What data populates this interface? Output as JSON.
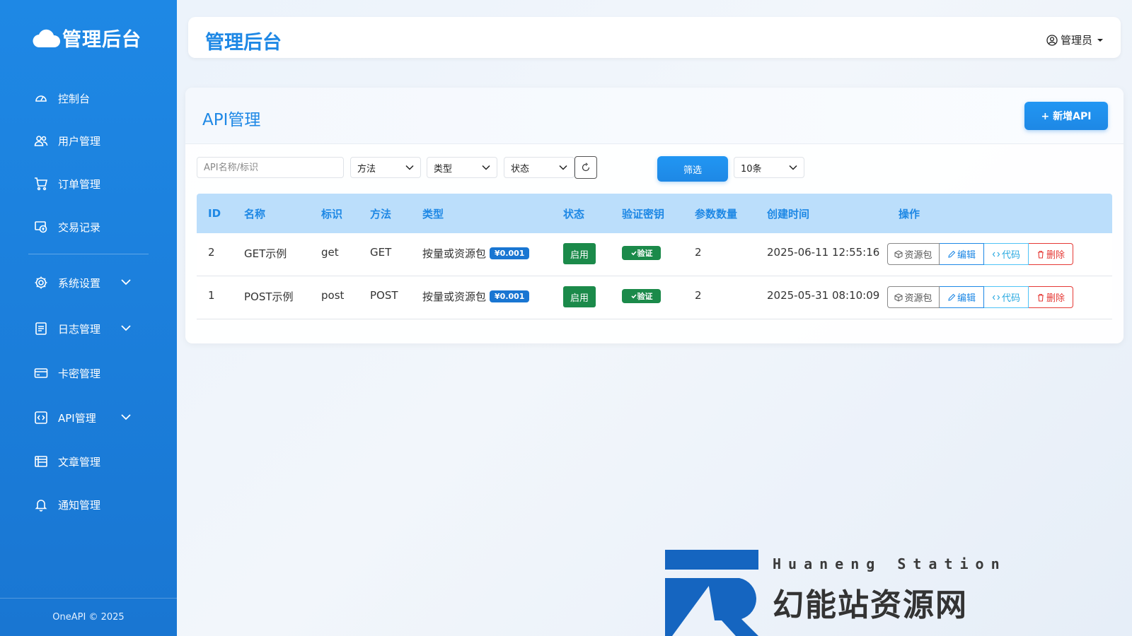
{
  "sidebar": {
    "brand": "管理后台",
    "items": [
      {
        "label": "控制台",
        "icon": "dashboard-icon"
      },
      {
        "label": "用户管理",
        "icon": "users-icon"
      },
      {
        "label": "订单管理",
        "icon": "cart-icon"
      },
      {
        "label": "交易记录",
        "icon": "transaction-icon"
      },
      {
        "label": "系统设置",
        "icon": "gear-icon"
      },
      {
        "label": "日志管理",
        "icon": "log-icon"
      },
      {
        "label": "卡密管理",
        "icon": "card-icon"
      },
      {
        "label": "API管理",
        "icon": "api-icon"
      },
      {
        "label": "文章管理",
        "icon": "article-icon"
      },
      {
        "label": "通知管理",
        "icon": "bell-icon"
      }
    ],
    "footer": "OneAPI © 2025"
  },
  "header": {
    "title": "管理后台",
    "user_label": "管理员"
  },
  "card": {
    "title": "API管理",
    "add_button": "+ 新增API"
  },
  "filters": {
    "search_placeholder": "API名称/标识",
    "method_label": "方法",
    "type_label": "类型",
    "status_label": "状态",
    "filter_button": "筛选",
    "page_size": "10条"
  },
  "table": {
    "columns": [
      "ID",
      "名称",
      "标识",
      "方法",
      "类型",
      "状态",
      "验证密钥",
      "参数数量",
      "创建时间",
      "操作"
    ],
    "rows": [
      {
        "id": "2",
        "name": "GET示例",
        "ident": "get",
        "method": "GET",
        "type": "按量或资源包",
        "price": "¥0.001",
        "status": "启用",
        "verify": "验证",
        "params": "2",
        "created": "2025-06-11 12:55:16"
      },
      {
        "id": "1",
        "name": "POST示例",
        "ident": "post",
        "method": "POST",
        "type": "按量或资源包",
        "price": "¥0.001",
        "status": "启用",
        "verify": "验证",
        "params": "2",
        "created": "2025-05-31 08:10:09"
      }
    ],
    "actions": {
      "package": "资源包",
      "edit": "编辑",
      "code": "代码",
      "delete": "删除"
    }
  },
  "watermark": {
    "subtitle": "Huaneng Station",
    "title": "幻能站资源网"
  },
  "colors": {
    "primary": "#1e88e5",
    "sidebar": "#1976d2",
    "success": "#1b8a4a",
    "danger": "#e53935",
    "table_header_bg": "#bbdefb"
  }
}
